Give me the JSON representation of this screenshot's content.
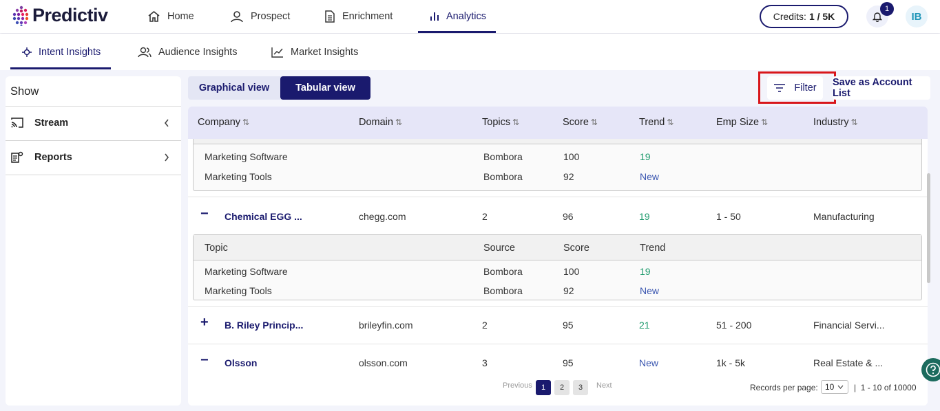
{
  "brand": {
    "name": "Predictiv"
  },
  "nav": [
    {
      "label": "Home",
      "icon": "home-icon"
    },
    {
      "label": "Prospect",
      "icon": "user-icon"
    },
    {
      "label": "Enrichment",
      "icon": "document-icon"
    },
    {
      "label": "Analytics",
      "icon": "bar-chart-icon",
      "active": true
    }
  ],
  "credits": {
    "label": "Credits:",
    "value": "1 / 5K"
  },
  "notifications": {
    "count": "1"
  },
  "user": {
    "initials": "IB"
  },
  "subtabs": [
    {
      "label": "Intent Insights",
      "active": true
    },
    {
      "label": "Audience Insights"
    },
    {
      "label": "Market Insights"
    }
  ],
  "sidebar": {
    "title": "Show",
    "items": [
      {
        "label": "Stream",
        "icon": "cast-icon",
        "chevron": "chevron-left-icon"
      },
      {
        "label": "Reports",
        "icon": "reports-icon",
        "chevron": "chevron-right-icon"
      }
    ]
  },
  "views": {
    "graphical": "Graphical view",
    "tabular": "Tabular view"
  },
  "actions": {
    "filter": "Filter",
    "save": "Save as Account List"
  },
  "table": {
    "headers": [
      "Company",
      "Domain",
      "Topics",
      "Score",
      "Trend",
      "Emp Size",
      "Industry"
    ],
    "sort_icon": "⇅",
    "sub_headers": {
      "topic": "Topic",
      "source": "Source",
      "score": "Score",
      "trend": "Trend"
    },
    "partial_sub": [
      {
        "topic": "Marketing Software",
        "source": "Bombora",
        "score": "100",
        "trend": "19"
      },
      {
        "topic": "Marketing Tools",
        "source": "Bombora",
        "score": "92",
        "trend": "New"
      }
    ],
    "rows": [
      {
        "toggle": "−",
        "company": "Chemical EGG ...",
        "domain": "chegg.com",
        "topics": "2",
        "score": "96",
        "trend": "19",
        "emp": "1 - 50",
        "industry": "Manufacturing",
        "sub": [
          {
            "topic": "Marketing Software",
            "source": "Bombora",
            "score": "100",
            "trend": "19"
          },
          {
            "topic": "Marketing Tools",
            "source": "Bombora",
            "score": "92",
            "trend": "New"
          }
        ]
      },
      {
        "toggle": "+",
        "company": "B. Riley Princip...",
        "domain": "brileyfin.com",
        "topics": "2",
        "score": "95",
        "trend": "21",
        "emp": "51 - 200",
        "industry": "Financial Servi..."
      },
      {
        "toggle": "−",
        "company": "Olsson",
        "domain": "olsson.com",
        "topics": "3",
        "score": "95",
        "trend": "New",
        "emp": "1k - 5k",
        "industry": "Real Estate & ..."
      }
    ]
  },
  "pagination": {
    "previous": "Previous",
    "pages": [
      "1",
      "2",
      "3"
    ],
    "next": "Next",
    "records_label": "Records per page:",
    "per_page": "10",
    "range": "1 - 10 of 10000"
  },
  "colors": {
    "primary": "#1a1a6e",
    "highlight": "#d8161b",
    "trend_green": "#1d9a6c",
    "trend_new": "#3a56b0"
  }
}
